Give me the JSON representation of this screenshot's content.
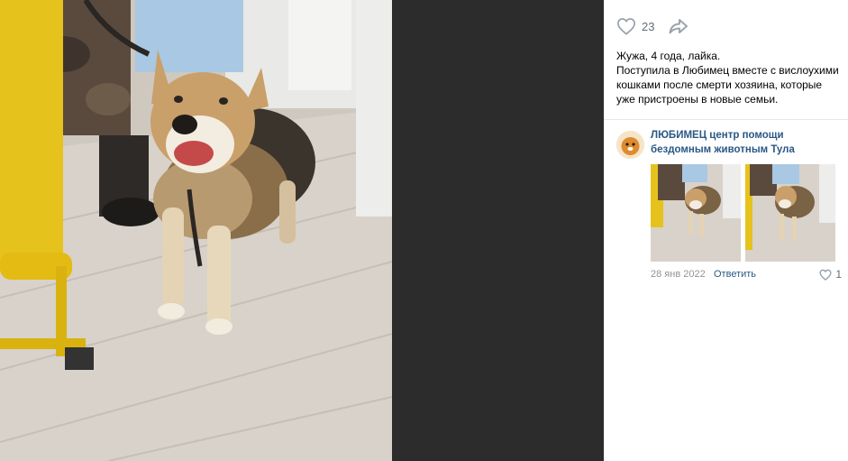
{
  "photo": {
    "alt_icon": "photo-dog"
  },
  "actions": {
    "like_icon": "heart-outline-icon",
    "like_count": "23",
    "share_icon": "share-arrow-icon"
  },
  "caption": {
    "line1": "Жужа, 4 года, лайка.",
    "line2": "Поступила в Любимец вместе с вислоухими кошками после смерти хозяина, которые уже пристроены в новые семьи."
  },
  "comment": {
    "author": "ЛЮБИМЕЦ центр помощи бездомным животным Тула",
    "date": "28 янв 2022",
    "reply_label": "Ответить",
    "like_count": "1",
    "like_icon": "heart-outline-icon"
  },
  "colors": {
    "link": "#2a5885",
    "muted": "#939393",
    "dark_bg": "#2c2c2c",
    "icon": "#99a2ad"
  }
}
